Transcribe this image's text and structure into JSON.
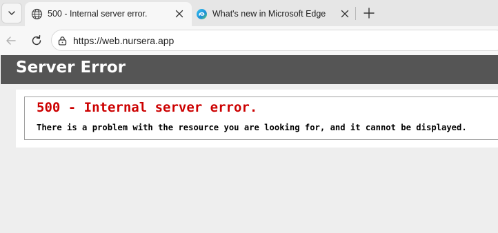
{
  "browser": {
    "tabs": [
      {
        "title": "500 - Internal server error.",
        "active": true,
        "favicon": "globe-icon"
      },
      {
        "title": "What's new in Microsoft Edge",
        "active": false,
        "favicon": "edge-icon"
      }
    ],
    "address_bar": {
      "url": "https://web.nursera.app"
    }
  },
  "page": {
    "header_title": "Server Error",
    "error_heading": "500 - Internal server error.",
    "error_message": "There is a problem with the resource you are looking for, and it cannot be displayed."
  },
  "colors": {
    "header_bg": "#555555",
    "error_red": "#cc0000"
  }
}
